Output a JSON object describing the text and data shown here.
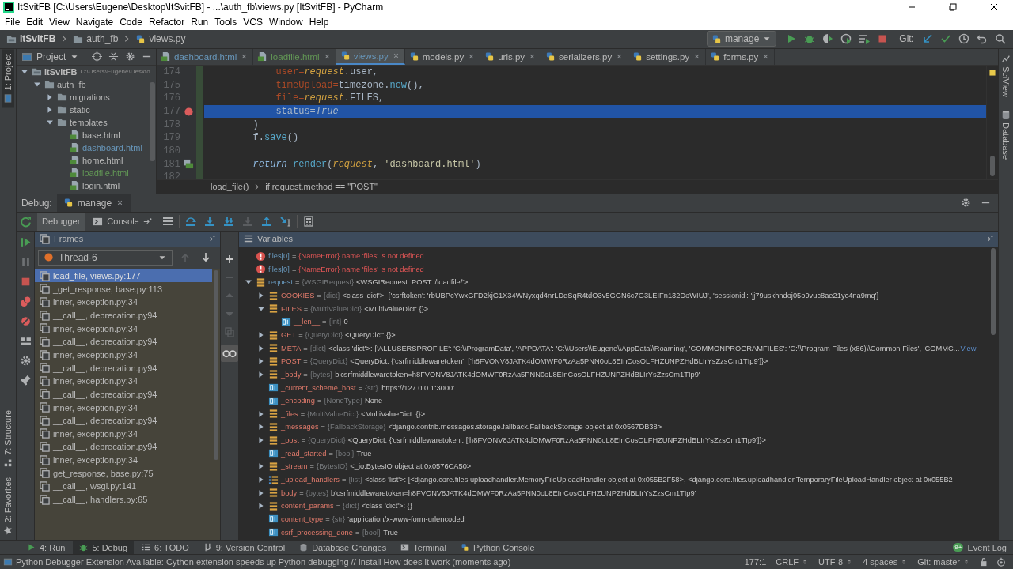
{
  "window": {
    "title": "ItSvitFB [C:\\Users\\Eugene\\Desktop\\ItSvitFB] - ...\\auth_fb\\views.py [ItSvitFB] - PyCharm"
  },
  "menu": [
    "File",
    "Edit",
    "View",
    "Navigate",
    "Code",
    "Refactor",
    "Run",
    "Tools",
    "VCS",
    "Window",
    "Help"
  ],
  "navigation": {
    "breadcrumbs": [
      {
        "label": "ItSvitFB",
        "kind": "project"
      },
      {
        "label": "auth_fb",
        "kind": "folder"
      },
      {
        "label": "views.py",
        "kind": "py"
      }
    ],
    "run_config": "manage",
    "git_label": "Git:"
  },
  "tool_strips": {
    "left_top": [
      {
        "label": "1: Project",
        "kind": "project",
        "selected": true
      }
    ],
    "left_bottom": [
      {
        "label": "7: Structure",
        "kind": "structure",
        "selected": false
      },
      {
        "label": "2: Favorites",
        "kind": "favorites",
        "selected": false
      }
    ],
    "right": [
      {
        "label": "SciView",
        "kind": "sciview"
      },
      {
        "label": "Database",
        "kind": "database"
      }
    ]
  },
  "project": {
    "title": "Project",
    "tree": [
      {
        "label": "ItSvitFB",
        "kind": "project",
        "path": "C:\\Users\\Eugene\\Deskto",
        "expanded": true,
        "children": [
          {
            "label": "auth_fb",
            "kind": "folder",
            "expanded": true,
            "children": [
              {
                "label": "migrations",
                "kind": "folder",
                "expanded": false
              },
              {
                "label": "static",
                "kind": "folder",
                "expanded": false
              },
              {
                "label": "templates",
                "kind": "folder",
                "expanded": true,
                "children": [
                  {
                    "label": "base.html",
                    "kind": "html"
                  },
                  {
                    "label": "dashboard.html",
                    "kind": "html",
                    "color": "#6897bb"
                  },
                  {
                    "label": "home.html",
                    "kind": "html"
                  },
                  {
                    "label": "loadfile.html",
                    "kind": "html",
                    "color": "#629755"
                  },
                  {
                    "label": "login.html",
                    "kind": "html"
                  }
                ]
              }
            ]
          }
        ]
      }
    ]
  },
  "editor": {
    "tabs": [
      {
        "label": "dashboard.html",
        "kind": "html",
        "color": "#6897bb",
        "selected": false
      },
      {
        "label": "loadfile.html",
        "kind": "html",
        "color": "#629755",
        "selected": false
      },
      {
        "label": "views.py",
        "kind": "py",
        "color": "#6897bb",
        "selected": true
      },
      {
        "label": "models.py",
        "kind": "py",
        "selected": false
      },
      {
        "label": "urls.py",
        "kind": "py",
        "selected": false
      },
      {
        "label": "serializers.py",
        "kind": "py",
        "selected": false
      },
      {
        "label": "settings.py",
        "kind": "py",
        "selected": false
      },
      {
        "label": "forms.py",
        "kind": "py",
        "selected": false
      }
    ],
    "lines": [
      {
        "number": "174",
        "current": false,
        "breakpoint": false,
        "tokens": [
          {
            "t": "            user=",
            "color": "#aa4926",
            "italic": false
          },
          {
            "t": "request",
            "color": "#d0a040",
            "italic": true
          },
          {
            "t": ".user,",
            "italic": false
          }
        ]
      },
      {
        "number": "175",
        "current": false,
        "breakpoint": false,
        "tokens": [
          {
            "t": "            timeUpload=",
            "color": "#aa4926",
            "italic": false
          },
          {
            "t": "timezone.",
            "italic": false
          },
          {
            "t": "now",
            "color": "#57a8c9",
            "italic": false
          },
          {
            "t": "(),",
            "italic": false
          }
        ]
      },
      {
        "number": "176",
        "current": false,
        "breakpoint": false,
        "tokens": [
          {
            "t": "            file=",
            "color": "#aa4926",
            "italic": false
          },
          {
            "t": "request",
            "color": "#d0a040",
            "italic": true
          },
          {
            "t": ".FILES,",
            "italic": false
          }
        ]
      },
      {
        "number": "177",
        "current": true,
        "breakpoint": true,
        "tokens": [
          {
            "t": "            status=",
            "italic": false
          },
          {
            "t": "True",
            "italic": true
          }
        ]
      },
      {
        "number": "178",
        "current": false,
        "breakpoint": false,
        "tokens": [
          {
            "t": "        )",
            "italic": false
          }
        ]
      },
      {
        "number": "179",
        "current": false,
        "breakpoint": false,
        "tokens": [
          {
            "t": "        f.",
            "italic": false
          },
          {
            "t": "save",
            "color": "#57a8c9",
            "italic": false
          },
          {
            "t": "()",
            "italic": false
          }
        ]
      },
      {
        "number": "180",
        "current": false,
        "breakpoint": false
      },
      {
        "number": "181",
        "current": false,
        "breakpoint": false,
        "template_marker": true,
        "tokens": [
          {
            "t": "        return",
            "color": "#8fb9e0",
            "italic": true
          },
          {
            "t": " render",
            "color": "#57a8c9",
            "italic": false
          },
          {
            "t": "(",
            "italic": false
          },
          {
            "t": "request",
            "color": "#d0a040",
            "italic": true
          },
          {
            "t": ", ",
            "italic": false
          },
          {
            "t": "'dashboard.html'",
            "color": "#c8c8a8",
            "italic": false
          },
          {
            "t": ")",
            "italic": false
          }
        ]
      },
      {
        "number": "182",
        "current": false,
        "breakpoint": false
      }
    ],
    "breadcrumbs": [
      "load_file()",
      "if request.method == \"POST\""
    ]
  },
  "debug": {
    "label": "Debug:",
    "session": "manage",
    "tabs": [
      {
        "label": "Debugger",
        "kind": "debugger",
        "selected": true
      },
      {
        "label": "Console",
        "kind": "console",
        "selected": false
      }
    ],
    "frames": {
      "title": "Frames",
      "thread": "Thread-6",
      "items": [
        {
          "label": "load_file, views.py:177",
          "selected": true
        },
        {
          "label": "_get_response, base.py:113",
          "selected": false
        },
        {
          "label": "inner, exception.py:34",
          "selected": false
        },
        {
          "label": "__call__, deprecation.py94",
          "selected": false
        },
        {
          "label": "inner, exception.py:34",
          "selected": false
        },
        {
          "label": "__call__, deprecation.py94",
          "selected": false
        },
        {
          "label": "inner, exception.py:34",
          "selected": false
        },
        {
          "label": "__call__, deprecation.py94",
          "selected": false
        },
        {
          "label": "inner, exception.py:34",
          "selected": false
        },
        {
          "label": "__call__, deprecation.py94",
          "selected": false
        },
        {
          "label": "inner, exception.py:34",
          "selected": false
        },
        {
          "label": "__call__, deprecation.py94",
          "selected": false
        },
        {
          "label": "inner, exception.py:34",
          "selected": false
        },
        {
          "label": "__call__, deprecation.py94",
          "selected": false
        },
        {
          "label": "inner, exception.py:34",
          "selected": false
        },
        {
          "label": "get_response, base.py:75",
          "selected": false
        },
        {
          "label": "__call__, wsgi.py:141",
          "selected": false
        },
        {
          "label": "__call__, handlers.py:65",
          "selected": false
        }
      ]
    },
    "variables": {
      "title": "Variables",
      "separator": "=",
      "items": [
        {
          "kind": "error",
          "name": "files[0]",
          "type": "{NameError}",
          "value": "name 'files' is not defined"
        },
        {
          "kind": "error",
          "name": "files[0]",
          "type": "{NameError}",
          "value": "name 'files' is not defined"
        },
        {
          "kind": "object",
          "name": "request",
          "type": "{WSGIRequest}",
          "value": "<WSGIRequest: POST '/loadfile/'>",
          "expanded": true,
          "children": [
            {
              "kind": "object",
              "name": "COOKIES",
              "type": "{dict}",
              "value": "<class 'dict'>: {'csrftoken': 'rbUBPcYwxGFD2kjG1X34WNyxqd4nrLDeSqR4tdO3v5GGN6c7G3LEIFn132DoWIUJ', 'sessionid': 'jj79uskhndoj05o9vuc8ae21yc4na9mq'}",
              "expanded": false
            },
            {
              "kind": "object",
              "name": "FILES",
              "type": "{MultiValueDict}",
              "value": "<MultiValueDict: {}>",
              "expanded": true,
              "children": [
                {
                  "kind": "primitive",
                  "name": "__len__",
                  "type": "{int}",
                  "value": "0"
                }
              ]
            },
            {
              "kind": "object",
              "name": "GET",
              "type": "{QueryDict}",
              "value": "<QueryDict: {}>",
              "expanded": false
            },
            {
              "kind": "object",
              "name": "META",
              "type": "{dict}",
              "value": "<class 'dict'>: {'ALLUSERSPROFILE': 'C:\\\\ProgramData', 'APPDATA': 'C:\\\\Users\\\\Eugene\\\\AppData\\\\Roaming', 'COMMONPROGRAMFILES': 'C:\\\\Program Files (x86)\\\\Common Files', 'COMMC...",
              "link": "View",
              "expanded": false
            },
            {
              "kind": "object",
              "name": "POST",
              "type": "{QueryDict}",
              "value": "<QueryDict: {'csrfmiddlewaretoken': ['h8FVONV8JATK4dOMWF0RzAa5PNN0oL8EInCosOLFHZUNPZHdBLIrYsZzsCm1TIp9']}>",
              "expanded": false
            },
            {
              "kind": "object",
              "name": "_body",
              "type": "{bytes}",
              "value": "b'csrfmiddlewaretoken=h8FVONV8JATK4dOMWF0RzAa5PNN0oL8EInCosOLFHZUNPZHdBLIrYsZzsCm1TIp9'",
              "expanded": false
            },
            {
              "kind": "primitive",
              "name": "_current_scheme_host",
              "type": "{str}",
              "value": "'https://127.0.0.1:3000'"
            },
            {
              "kind": "primitive",
              "name": "_encoding",
              "type": "{NoneType}",
              "value": "None"
            },
            {
              "kind": "object",
              "name": "_files",
              "type": "{MultiValueDict}",
              "value": "<MultiValueDict: {}>",
              "expanded": false
            },
            {
              "kind": "object",
              "name": "_messages",
              "type": "{FallbackStorage}",
              "value": "<django.contrib.messages.storage.fallback.FallbackStorage object at 0x0567DB38>",
              "expanded": false
            },
            {
              "kind": "object",
              "name": "_post",
              "type": "{QueryDict}",
              "value": "<QueryDict: {'csrfmiddlewaretoken': ['h8FVONV8JATK4dOMWF0RzAa5PNN0oL8EInCosOLFHZUNPZHdBLIrYsZzsCm1TIp9']}>",
              "expanded": false
            },
            {
              "kind": "primitive",
              "name": "_read_started",
              "type": "{bool}",
              "value": "True"
            },
            {
              "kind": "object",
              "name": "_stream",
              "type": "{BytesIO}",
              "value": "<_io.BytesIO object at 0x0576CA50>",
              "expanded": false
            },
            {
              "kind": "list",
              "name": "_upload_handlers",
              "type": "{list}",
              "value": "<class 'list'>: [<django.core.files.uploadhandler.MemoryFileUploadHandler object at 0x055B2F58>, <django.core.files.uploadhandler.TemporaryFileUploadHandler object at 0x055B2",
              "expanded": false
            },
            {
              "kind": "object",
              "name": "body",
              "type": "{bytes}",
              "value": "b'csrfmiddlewaretoken=h8FVONV8JATK4dOMWF0RzAa5PNN0oL8EInCosOLFHZUNPZHdBLIrYsZzsCm1TIp9'",
              "expanded": false
            },
            {
              "kind": "object",
              "name": "content_params",
              "type": "{dict}",
              "value": "<class 'dict'>: {}",
              "expanded": false
            },
            {
              "kind": "primitive",
              "name": "content_type",
              "type": "{str}",
              "value": "'application/x-www-form-urlencoded'"
            },
            {
              "kind": "primitive",
              "name": "csrf_processing_done",
              "type": "{bool}",
              "value": "True"
            }
          ]
        }
      ]
    }
  },
  "tool_tabs": [
    {
      "label": "4: Run",
      "kind": "run",
      "selected": false
    },
    {
      "label": "5: Debug",
      "kind": "debug",
      "selected": true
    },
    {
      "label": "6: TODO",
      "kind": "todo",
      "selected": false
    },
    {
      "label": "9: Version Control",
      "kind": "vcs",
      "selected": false
    },
    {
      "label": "Database Changes",
      "kind": "database",
      "selected": false
    },
    {
      "label": "Terminal",
      "kind": "terminal",
      "selected": false
    },
    {
      "label": "Python Console",
      "kind": "console",
      "selected": false
    }
  ],
  "event_log": {
    "label": "Event Log",
    "badge": "9+"
  },
  "status_bar": {
    "message": "Python Debugger Extension Available: Cython extension speeds up Python debugging // Install How does it work (moments ago)",
    "items": [
      {
        "label": "177:1",
        "dropdown": false
      },
      {
        "label": "CRLF",
        "dropdown": true
      },
      {
        "label": "UTF-8",
        "dropdown": true
      },
      {
        "label": "4 spaces",
        "dropdown": true
      },
      {
        "label": "Git: master",
        "dropdown": true
      }
    ]
  }
}
